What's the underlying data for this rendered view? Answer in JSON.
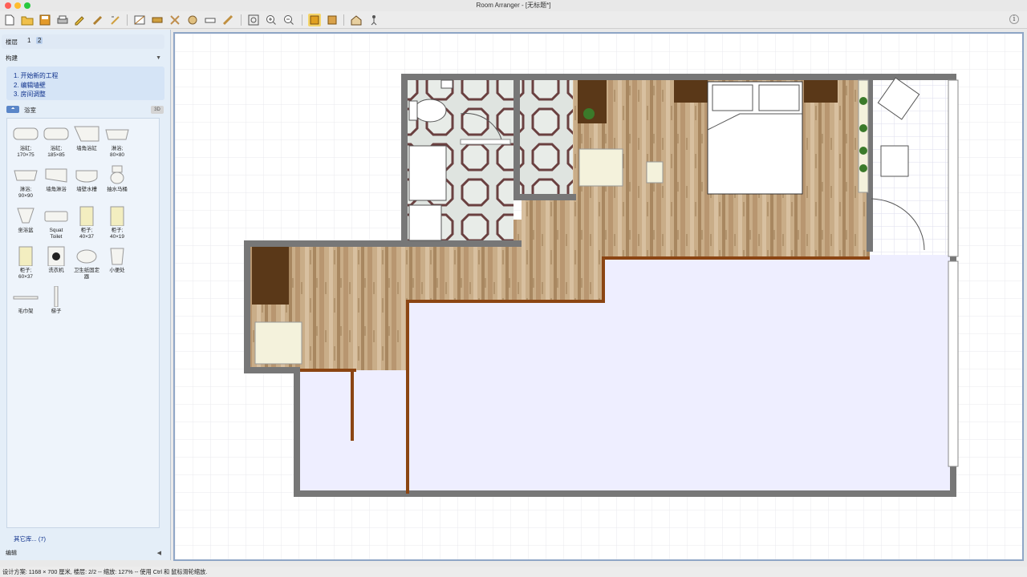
{
  "window": {
    "title": "Room Arranger - [无标题*]"
  },
  "toolbar": {
    "icons": [
      "new-icon",
      "open-icon",
      "save-icon",
      "print-icon",
      "edit-icon",
      "settings-icon",
      "fit-icon",
      "measure-icon",
      "rotate-icon",
      "flip-icon",
      "align-icon",
      "pencil-icon",
      "zoom-fit-icon",
      "zoom-in-icon",
      "zoom-out-icon",
      "3d-view-icon",
      "3d-house-icon",
      "house-icon",
      "walk-icon",
      "info-icon"
    ],
    "info_glyph": "i"
  },
  "sidebar": {
    "floor_label": "楼层",
    "floors": [
      "1",
      "2"
    ],
    "active_floor": "2",
    "build_label": "构建",
    "steps": [
      "1. 开始新的工程",
      "2. 编辑墙壁",
      "3. 房间调整"
    ],
    "library_name": "浴室",
    "library_3d_badge": "3D",
    "items": [
      {
        "label": "浴缸;\n170×75",
        "icon": "bathtub-icon"
      },
      {
        "label": "浴缸;\n185×85",
        "icon": "bathtub-icon"
      },
      {
        "label": "墙角浴缸",
        "icon": "corner-bathtub-icon"
      },
      {
        "label": "淋浴;\n80×80",
        "icon": "shower-icon"
      },
      {
        "label": "淋浴;\n90×90",
        "icon": "shower-icon"
      },
      {
        "label": "墙角淋浴",
        "icon": "corner-shower-icon"
      },
      {
        "label": "墙壁水槽",
        "icon": "wall-sink-icon"
      },
      {
        "label": "抽水马桶",
        "icon": "toilet-icon"
      },
      {
        "label": "坐浴盆",
        "icon": "bidet-icon"
      },
      {
        "label": "Squat\nToilet",
        "icon": "squat-toilet-icon"
      },
      {
        "label": "柜子;\n40×37",
        "icon": "cabinet-icon"
      },
      {
        "label": "柜子;\n40×19",
        "icon": "cabinet-icon"
      },
      {
        "label": "柜子;\n60×37",
        "icon": "cabinet-icon"
      },
      {
        "label": "洗衣机",
        "icon": "washing-machine-icon"
      },
      {
        "label": "卫生纸固定\n器",
        "icon": "paper-holder-icon"
      },
      {
        "label": "小便处",
        "icon": "urinal-icon"
      },
      {
        "label": "毛巾架",
        "icon": "towel-rack-icon"
      },
      {
        "label": "梯子",
        "icon": "ladder-icon"
      }
    ],
    "more_libraries": "其它库... (7)",
    "edit_label": "编辑"
  },
  "status": {
    "text": "设计方案: 1168 × 700 厘米, 楼层: 2/2 -- 缩放: 127% -- 使用 Ctrl 和 鼠标滑轮缩放."
  },
  "colors": {
    "accent": "#0b2e8a",
    "wall": "#777777",
    "partition": "#8b4513",
    "room_fill": "#eeeeff",
    "wood": "#c8ab86"
  }
}
